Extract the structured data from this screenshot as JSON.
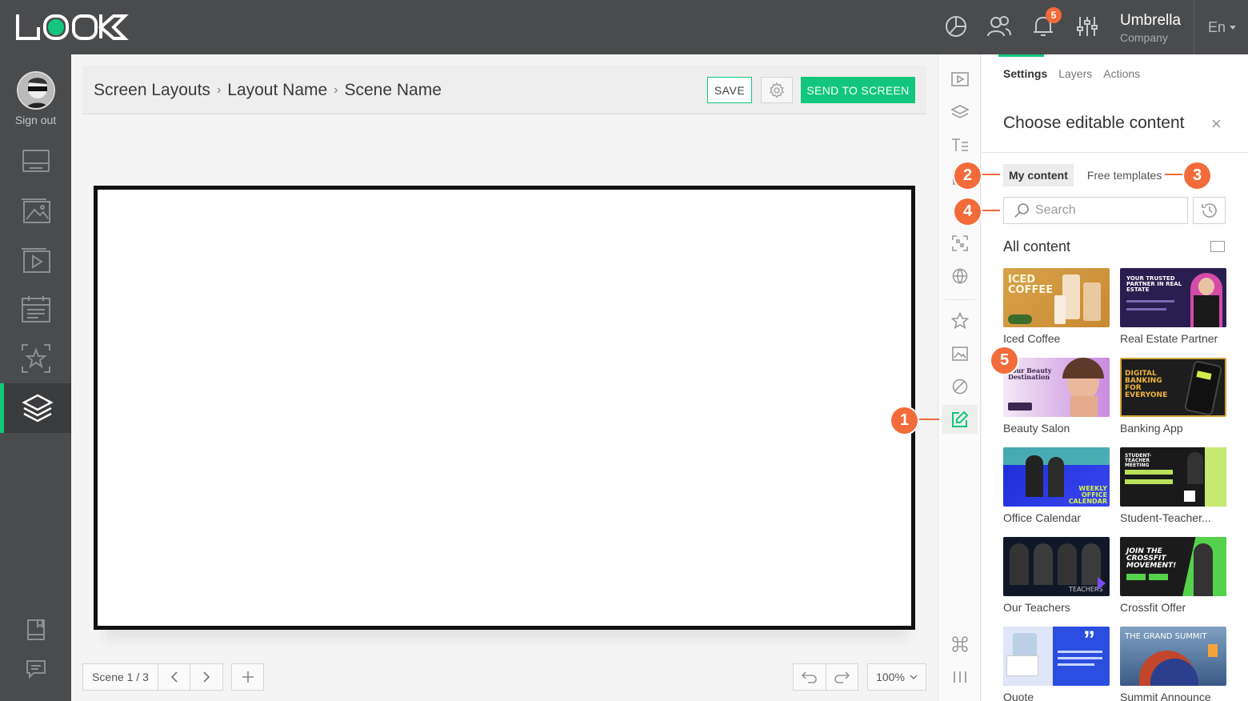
{
  "app": {
    "logo_text": "LOOK"
  },
  "topbar": {
    "notifications_count": "5",
    "company_name": "Umbrella",
    "company_sub": "Company",
    "language": "En"
  },
  "sidebar": {
    "signout_label": "Sign out"
  },
  "breadcrumb": [
    "Screen Layouts",
    "Layout Name",
    "Scene Name"
  ],
  "toolbar": {
    "save_label": "SAVE",
    "send_label": "SEND TO SCREEN"
  },
  "bottom": {
    "scene_label": "Scene 1 / 3",
    "zoom_label": "100%"
  },
  "panel": {
    "tabs": [
      "Settings",
      "Layers",
      "Actions"
    ],
    "title": "Choose editable content",
    "segment_my": "My content",
    "segment_free": "Free templates",
    "search_placeholder": "Search",
    "section_title": "All content",
    "items": [
      {
        "label": "Iced Coffee",
        "thumb_text": "ICED COFFEE"
      },
      {
        "label": "Real Estate Partner",
        "thumb_text": "YOUR TRUSTED PARTNER IN REAL ESTATE"
      },
      {
        "label": "Beauty Salon",
        "thumb_text": "Your Beauty Destination"
      },
      {
        "label": "Banking App",
        "thumb_text": "DIGITAL BANKING FOR EVERYONE"
      },
      {
        "label": "Office Calendar",
        "thumb_text": "WEEKLY OFFICE CALENDAR"
      },
      {
        "label": "Student-Teacher...",
        "thumb_text": "STUDENT-TEACHER MEETING"
      },
      {
        "label": "Our Teachers",
        "thumb_text": "TEACHERS"
      },
      {
        "label": "Crossfit Offer",
        "thumb_text": "JOIN THE CROSSFIT MOVEMENT!"
      },
      {
        "label": "Quote",
        "thumb_text": ""
      },
      {
        "label": "Summit Announce",
        "thumb_text": "THE GRAND SUMMIT"
      }
    ]
  },
  "callouts": [
    "1",
    "2",
    "3",
    "4",
    "5"
  ],
  "colors": {
    "accent": "#12c77c",
    "callout": "#f26b3a",
    "chrome": "#4a4b4d"
  }
}
